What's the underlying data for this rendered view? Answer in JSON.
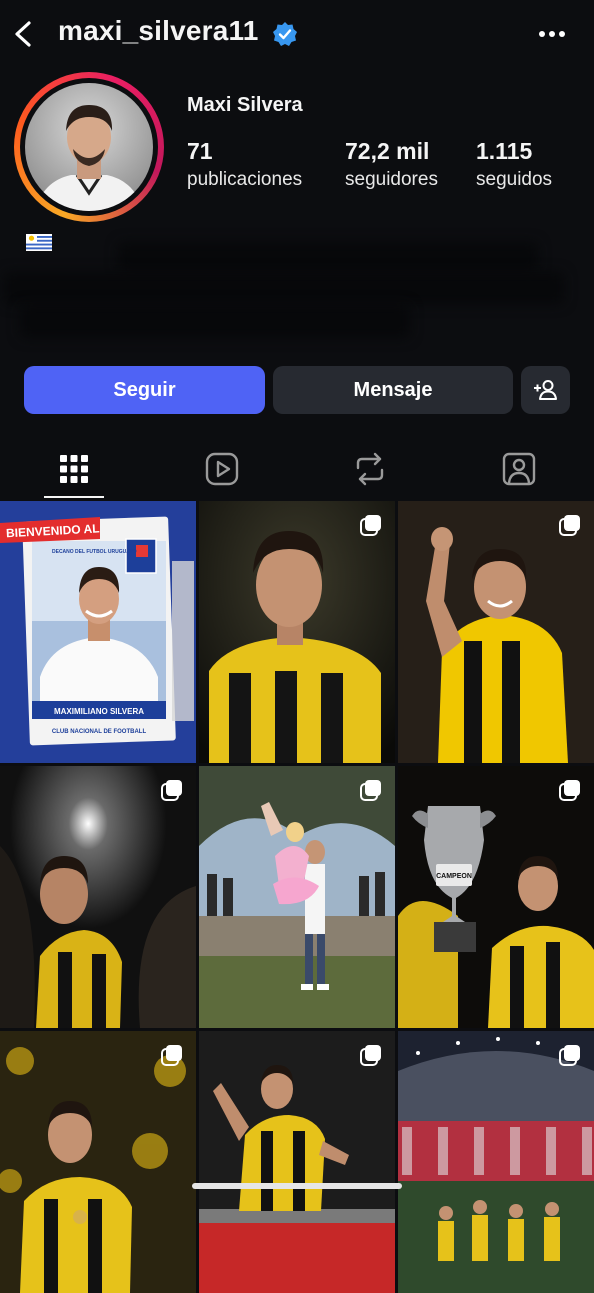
{
  "header": {
    "username": "maxi_silvera11",
    "back_icon": "chevron-left-icon",
    "verified_icon": "verified-badge-icon",
    "more_icon": "more-horizontal-icon"
  },
  "profile": {
    "full_name": "Maxi Silvera",
    "flag": "uruguay-flag",
    "stats": [
      {
        "number": "71",
        "label": "publicaciones"
      },
      {
        "number": "72,2 mil",
        "label": "seguidores"
      },
      {
        "number": "1.115",
        "label": "seguidos"
      }
    ]
  },
  "actions": {
    "follow_label": "Seguir",
    "message_label": "Mensaje",
    "add_user_icon": "add-person-icon"
  },
  "tabs": [
    {
      "icon": "grid-icon"
    },
    {
      "icon": "reels-icon"
    },
    {
      "icon": "repost-icon"
    },
    {
      "icon": "tagged-icon"
    }
  ],
  "posts": [
    {
      "kind": "nacional-sticker",
      "multi": false,
      "overlay_text": "BIENVENIDO AL",
      "caption": "MAXIMILIANO SILVERA",
      "footer": "CLUB NACIONAL DE FOOTBALL",
      "sub": "DECANO DEL FUTBOL URUGUAYO"
    },
    {
      "kind": "player-dark",
      "multi": true
    },
    {
      "kind": "player-celebrating",
      "multi": true
    },
    {
      "kind": "player-stadium-lights",
      "multi": true
    },
    {
      "kind": "family-park",
      "multi": true
    },
    {
      "kind": "trophy",
      "multi": true,
      "trophy_text": "CAMPEON"
    },
    {
      "kind": "player-medal",
      "multi": true
    },
    {
      "kind": "player-running",
      "multi": true
    },
    {
      "kind": "stadium",
      "multi": true
    }
  ],
  "colors": {
    "background": "#0c0d10",
    "follow_button": "#4f63f5",
    "secondary_button": "#272a31",
    "verified": "#3897f0",
    "penarol_yellow": "#f2c400"
  }
}
